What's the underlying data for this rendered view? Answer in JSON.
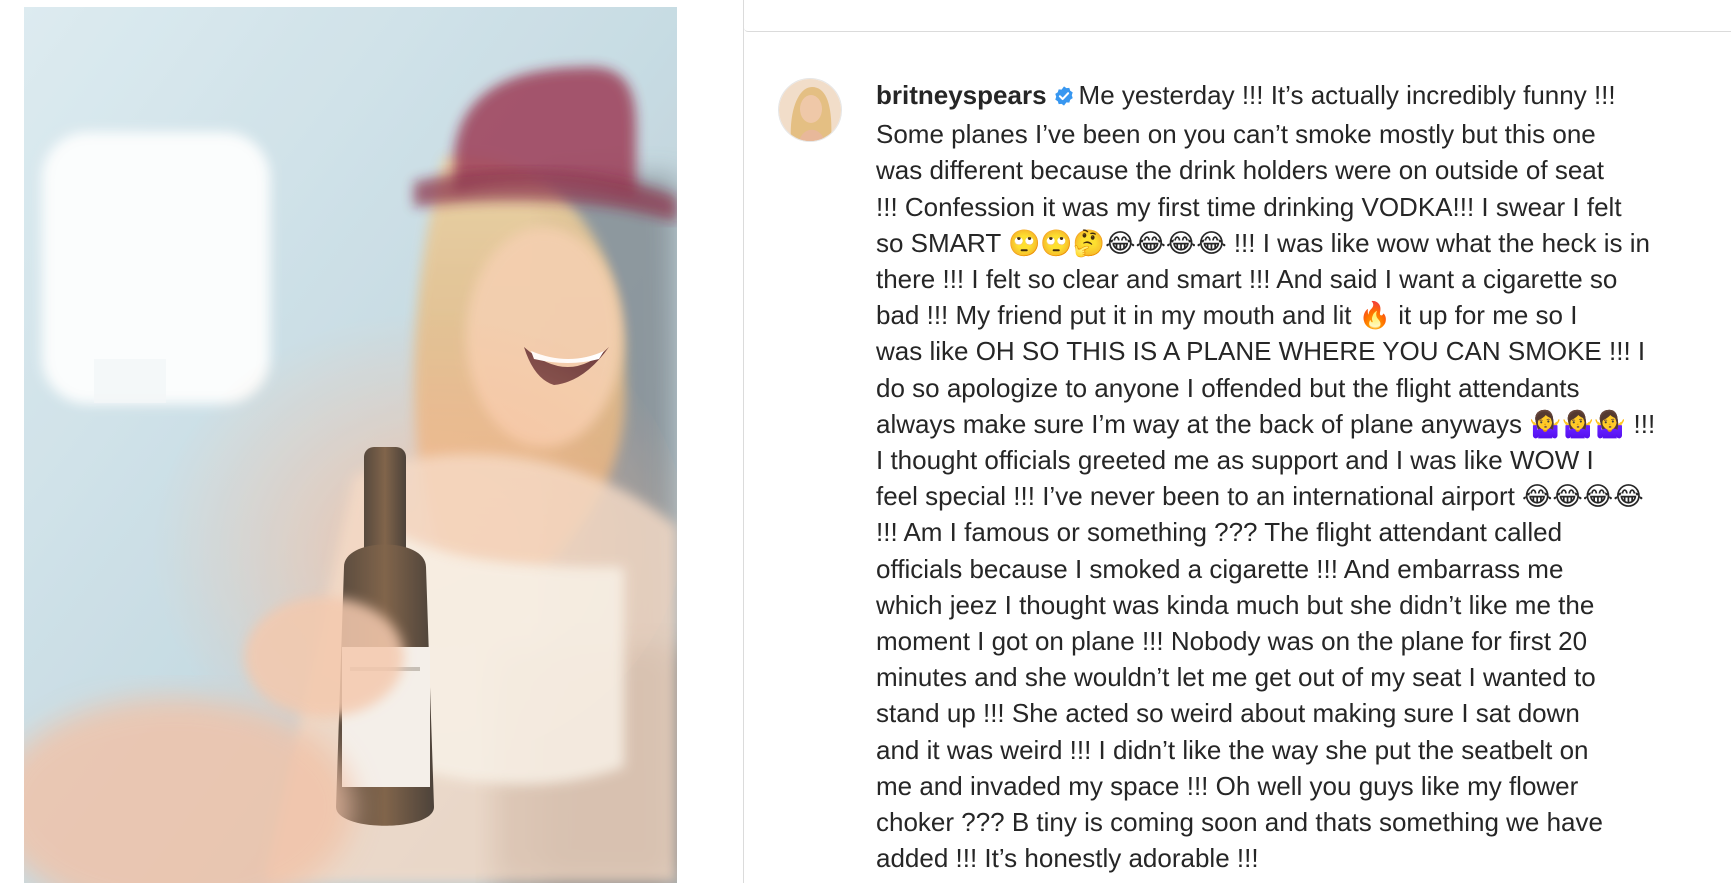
{
  "post": {
    "media_alt": "",
    "author": {
      "username": "britneyspears",
      "verified": true,
      "verified_icon": "verified-badge-icon",
      "verified_color": "#3897f0"
    },
    "caption_lines": [
      "Me yesterday !!! It’s actually incredibly funny !!!",
      "Some planes I’ve been on you can’t smoke mostly but this one",
      "was different because the drink holders were on outside of seat",
      "!!! Confession it was my first time drinking VODKA!!! I swear I felt",
      "so SMART 🙄🙄🤔😂😂😂😂 !!! I was like wow what the heck is in",
      "there !!! I felt so clear and smart !!! And said I want a cigarette so",
      "bad !!! My friend put it in my mouth and lit 🔥 it up for me so I",
      "was like OH SO THIS IS A PLANE WHERE YOU CAN SMOKE !!! I",
      "do so apologize to anyone I offended but the flight attendants",
      "always make sure I’m way at the back of plane anyways 🤷‍♀️🤷‍♀️🤷‍♀️ !!!",
      "I thought officials greeted me as support and I was like WOW I",
      "feel special !!! I’ve never been to an international airport 😂😂😂😂",
      "!!! Am I famous or something ??? The flight attendant called",
      "officials because I smoked a cigarette !!! And embarrass me",
      "which jeez I thought was kinda much but she didn’t like me the",
      "moment I got on plane !!! Nobody was on the plane for first 20",
      "minutes and she wouldn’t let me get out of my seat I wanted to",
      "stand up !!! She acted so weird about making sure I sat down",
      "and it was weird !!! I didn’t like the way she put the seatbelt on",
      "me and invaded my space !!! Oh well you guys like my flower",
      "choker ??? B tiny is coming soon and thats something we have",
      "added !!! It’s honestly adorable !!!"
    ]
  },
  "colors": {
    "text": "#262626",
    "border": "#dbdbdb",
    "hat": "#8c1d3a"
  }
}
